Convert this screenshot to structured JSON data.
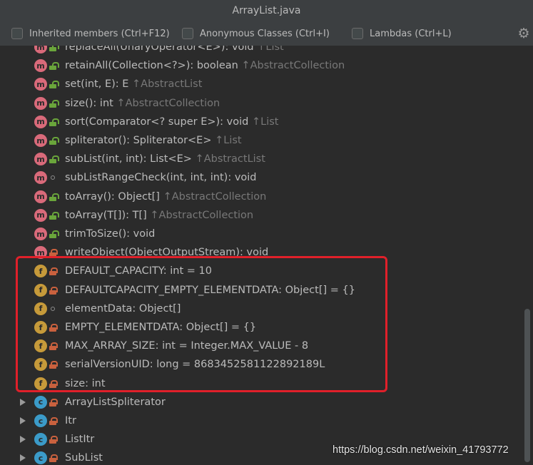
{
  "window": {
    "title": "ArrayList.java"
  },
  "toolbar": {
    "inherited": "Inherited members (Ctrl+F12)",
    "anonymous": "Anonymous Classes (Ctrl+I)",
    "lambdas": "Lambdas (Ctrl+L)",
    "settings_icon": "gear-icon"
  },
  "tree": {
    "items": [
      {
        "kind": "method",
        "access": "public",
        "sig": "replaceAll(UnaryOperator<E>): void",
        "inh": "↑List"
      },
      {
        "kind": "method",
        "access": "public",
        "sig": "retainAll(Collection<?>): boolean",
        "inh": "↑AbstractCollection"
      },
      {
        "kind": "method",
        "access": "public",
        "sig": "set(int, E): E",
        "inh": "↑AbstractList"
      },
      {
        "kind": "method",
        "access": "public",
        "sig": "size(): int",
        "inh": "↑AbstractCollection"
      },
      {
        "kind": "method",
        "access": "public",
        "sig": "sort(Comparator<? super E>): void",
        "inh": "↑List"
      },
      {
        "kind": "method",
        "access": "public",
        "sig": "spliterator(): Spliterator<E>",
        "inh": "↑List"
      },
      {
        "kind": "method",
        "access": "public",
        "sig": "subList(int, int): List<E>",
        "inh": "↑AbstractList"
      },
      {
        "kind": "method",
        "access": "package",
        "sig": "subListRangeCheck(int, int, int): void",
        "inh": ""
      },
      {
        "kind": "method",
        "access": "public",
        "sig": "toArray(): Object[]",
        "inh": "↑AbstractCollection"
      },
      {
        "kind": "method",
        "access": "public",
        "sig": "toArray(T[]): T[]",
        "inh": "↑AbstractCollection"
      },
      {
        "kind": "method",
        "access": "public",
        "sig": "trimToSize(): void",
        "inh": ""
      },
      {
        "kind": "method",
        "access": "private",
        "sig": "writeObject(ObjectOutputStream): void",
        "inh": ""
      },
      {
        "kind": "field",
        "access": "private",
        "sig": "DEFAULT_CAPACITY: int = 10",
        "inh": ""
      },
      {
        "kind": "field",
        "access": "private",
        "sig": "DEFAULTCAPACITY_EMPTY_ELEMENTDATA: Object[] = {}",
        "inh": ""
      },
      {
        "kind": "field",
        "access": "package",
        "sig": "elementData: Object[]",
        "inh": ""
      },
      {
        "kind": "field",
        "access": "private",
        "sig": "EMPTY_ELEMENTDATA: Object[] = {}",
        "inh": ""
      },
      {
        "kind": "field",
        "access": "private",
        "sig": "MAX_ARRAY_SIZE: int = Integer.MAX_VALUE - 8",
        "inh": ""
      },
      {
        "kind": "field",
        "access": "private",
        "sig": "serialVersionUID: long = 8683452581122892189L",
        "inh": ""
      },
      {
        "kind": "field",
        "access": "private",
        "sig": "size: int",
        "inh": ""
      },
      {
        "kind": "class",
        "access": "private",
        "sig": "ArrayListSpliterator",
        "inh": ""
      },
      {
        "kind": "class",
        "access": "private",
        "sig": "Itr",
        "inh": ""
      },
      {
        "kind": "class",
        "access": "private",
        "sig": "ListItr",
        "inh": ""
      },
      {
        "kind": "class",
        "access": "private",
        "sig": "SubList",
        "inh": ""
      }
    ]
  },
  "colors": {
    "method_icon": "#d96a7a",
    "field_icon": "#c69a3a",
    "class_icon": "#3b9bc9",
    "highlight_border": "#e0202a"
  },
  "watermark": "https://blog.csdn.net/weixin_41793772"
}
